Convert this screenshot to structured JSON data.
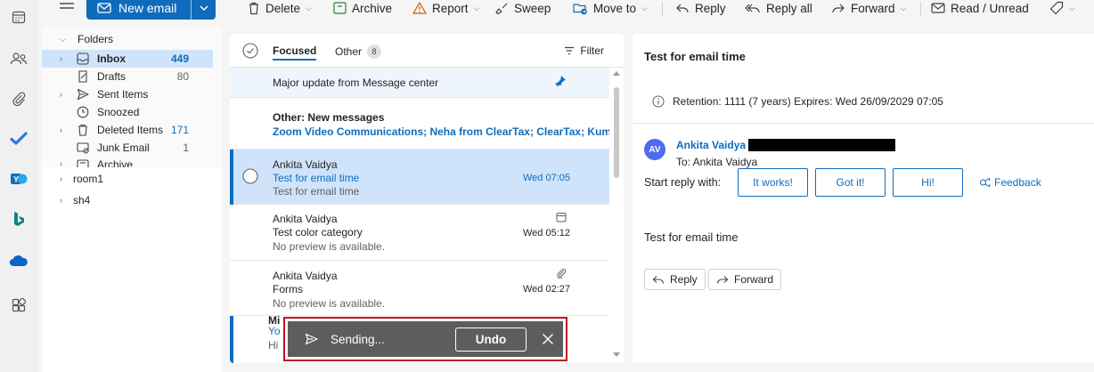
{
  "ribbon": {
    "new_email": "New email",
    "delete": "Delete",
    "archive": "Archive",
    "report": "Report",
    "sweep": "Sweep",
    "move_to": "Move to",
    "reply": "Reply",
    "reply_all": "Reply all",
    "forward": "Forward",
    "read_unread": "Read / Unread"
  },
  "rail": {
    "icons": [
      "calendar-icon",
      "people-icon",
      "paperclip-icon",
      "todo-check-icon",
      "yammer-icon",
      "bing-icon",
      "onedrive-icon",
      "apps-icon"
    ]
  },
  "folders": {
    "heading": "Folders",
    "items": [
      {
        "label": "Inbox",
        "count": "449",
        "icon": "inbox-icon",
        "expander": true
      },
      {
        "label": "Drafts",
        "count": "80",
        "icon": "drafts-icon",
        "expander": false
      },
      {
        "label": "Sent Items",
        "count": "",
        "icon": "send-icon",
        "expander": true
      },
      {
        "label": "Snoozed",
        "count": "",
        "icon": "clock-icon",
        "expander": false
      },
      {
        "label": "Deleted Items",
        "count": "171",
        "icon": "trash-icon",
        "expander": true
      },
      {
        "label": "Junk Email",
        "count": "1",
        "icon": "junk-icon",
        "expander": false
      },
      {
        "label": "Archive",
        "count": "",
        "icon": "archive-icon",
        "expander": true
      }
    ],
    "groups": [
      "room1",
      "sh4"
    ]
  },
  "list": {
    "tab_focused": "Focused",
    "tab_other": "Other",
    "other_count": "8",
    "filter": "Filter",
    "messages": [
      {
        "subject": "Major update from Message center"
      },
      {
        "title": "Other: New messages",
        "senders": "Zoom Video Communications; Neha from ClearTax; ClearTax; Kum..."
      },
      {
        "sender": "Ankita Vaidya",
        "subject": "Test for email time",
        "preview": "Test for email time",
        "date": "Wed 07:05"
      },
      {
        "sender": "Ankita Vaidya",
        "subject": "Test color category",
        "preview": "No preview is available.",
        "date": "Wed 05:12"
      },
      {
        "sender": "Ankita Vaidya",
        "subject": "Forms",
        "preview": "No preview is available.",
        "date": "Wed 02:27"
      },
      {
        "sender": "Mi",
        "subject": "Yo",
        "preview": "Hi"
      }
    ]
  },
  "reader": {
    "subject": "Test for email time",
    "retention": "Retention: 1111 (7 years) Expires: Wed 26/09/2029 07:05",
    "avatar_initials": "AV",
    "from": "Ankita Vaidya",
    "to": "To: Ankita Vaidya",
    "start_reply": "Start reply with:",
    "quick_replies": [
      "It works!",
      "Got it!",
      "Hi!"
    ],
    "feedback": "Feedback",
    "body": "Test for email time",
    "reply": "Reply",
    "forward": "Forward"
  },
  "toast": {
    "message": "Sending...",
    "undo": "Undo"
  },
  "colors": {
    "accent": "#0f6cbd",
    "selected": "#cfe4fa",
    "toast_border": "#c50f1f",
    "toast_bg": "#5d5d5d"
  }
}
